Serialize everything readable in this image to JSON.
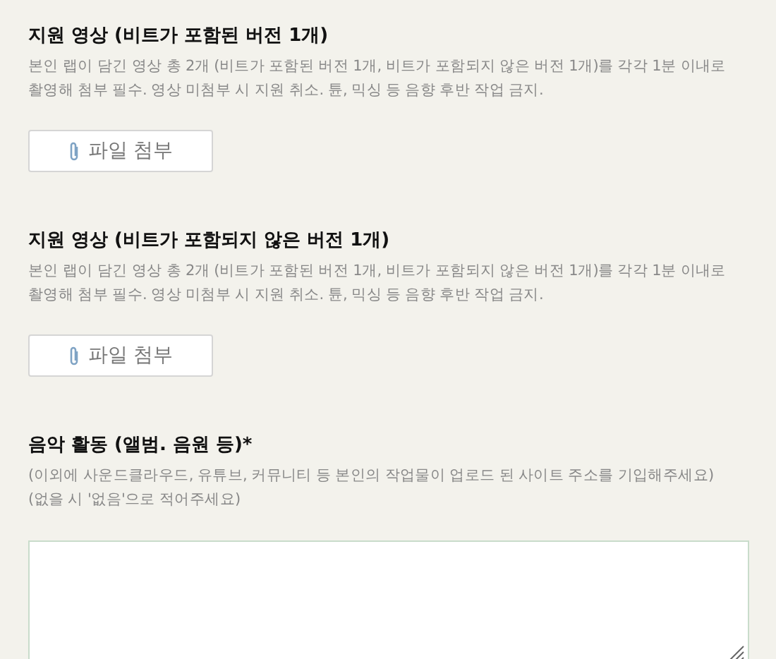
{
  "fields": [
    {
      "kind": "file",
      "title": "지원 영상 (비트가 포함된 버전 1개)",
      "description": [
        "본인 랩이 담긴 영상 총 2개 (비트가 포함된 버전 1개, 비트가 포함되지 않은 버전 1개)를 각각 1분 이내로",
        "촬영해 첨부 필수. 영상 미첨부 시 지원 취소. 튠, 믹싱 등 음향 후반 작업 금지."
      ],
      "button": "파일 첨부"
    },
    {
      "kind": "file",
      "title": "지원 영상 (비트가 포함되지 않은 버전 1개)",
      "description": [
        "본인 랩이 담긴 영상 총 2개 (비트가 포함된 버전 1개, 비트가 포함되지 않은 버전 1개)를 각각 1분 이내로",
        "촬영해 첨부 필수. 영상 미첨부 시 지원 취소. 튠, 믹싱 등 음향 후반 작업 금지."
      ],
      "button": "파일 첨부"
    },
    {
      "kind": "textarea",
      "title": "음악 활동 (앨범. 음원 등)*",
      "description": [
        "(이외에 사운드클라우드, 유튜브, 커뮤니티 등 본인의 작업물이 업로드 된 사이트 주소를 기입해주세요)",
        "(없을 시 '없음'으로 적어주세요)"
      ]
    }
  ]
}
